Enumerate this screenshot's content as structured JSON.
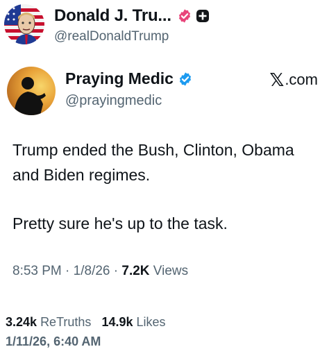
{
  "truth_post": {
    "author": {
      "display_name": "Donald J. Tru...",
      "handle": "@realDonaldTrump",
      "avatar_icon": "flag-portrait-avatar",
      "verified_badge_icon": "verified-pink-icon",
      "plus_badge_icon": "plus-badge-icon"
    },
    "stats": {
      "retruths_count": "3.24k",
      "retruths_label": "ReTruths",
      "likes_count": "14.9k",
      "likes_label": "Likes"
    },
    "timestamp": "1/11/26, 6:40 AM"
  },
  "embedded_post": {
    "author": {
      "display_name": "Praying Medic",
      "handle": "@prayingmedic",
      "avatar_icon": "silhouette-sunset-avatar",
      "verified_badge_icon": "verified-blue-icon"
    },
    "source": {
      "mark": "𝕏",
      "label": ".com"
    },
    "body": {
      "paragraph_1": "Trump ended the Bush, Clinton, Obama and Biden regimes.",
      "paragraph_2": "Pretty sure he's up to the task."
    },
    "meta": {
      "time": "8:53 PM",
      "separator": "·",
      "date": "1/8/26",
      "views_count": "7.2K",
      "views_label": "Views"
    }
  },
  "colors": {
    "text_primary": "#0f1419",
    "text_secondary": "#536471",
    "verified_pink": "#e8457a",
    "verified_blue": "#1d9bf0"
  }
}
